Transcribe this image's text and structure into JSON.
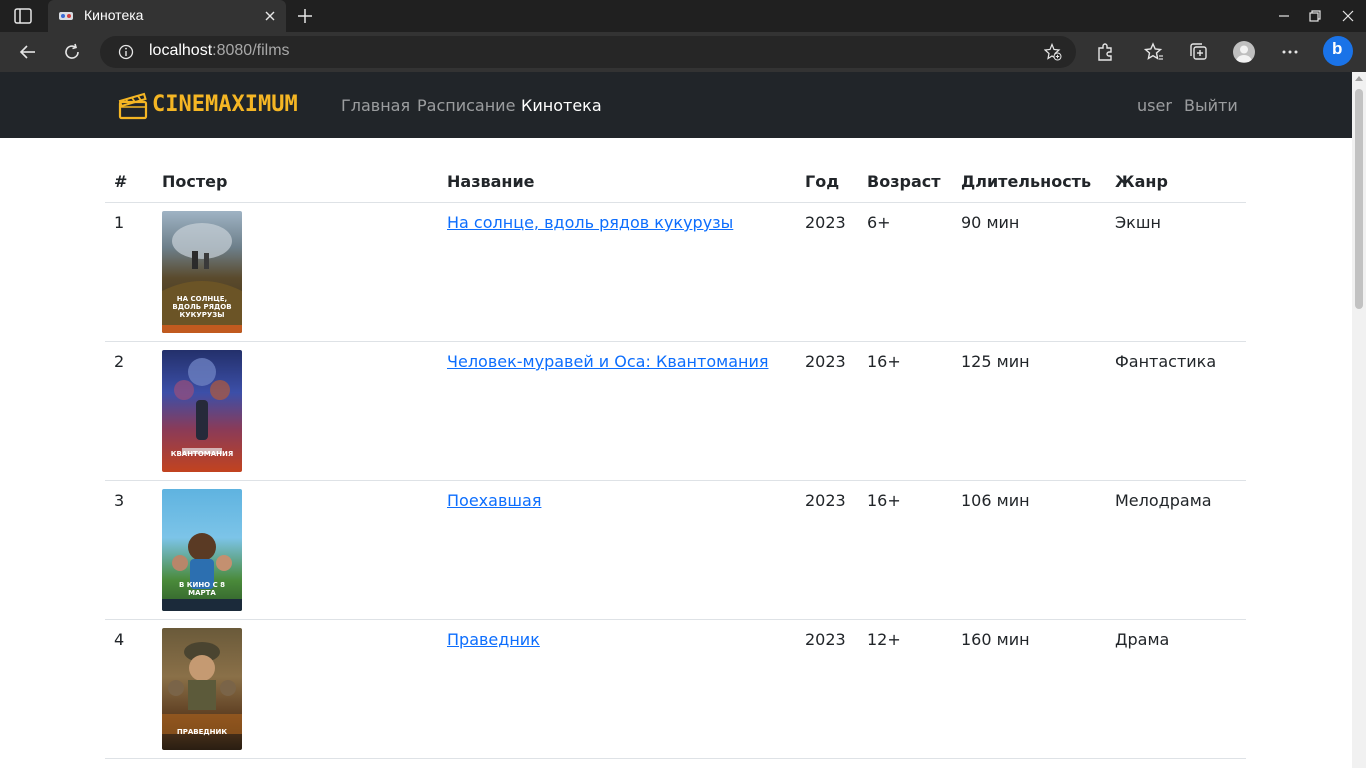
{
  "browser": {
    "tab_title": "Кинотека",
    "url_host": "localhost",
    "url_rest": ":8080/films"
  },
  "site": {
    "brand": "CINEMAXIMUM",
    "nav": [
      {
        "label": "Главная",
        "active": false
      },
      {
        "label": "Расписание",
        "active": false
      },
      {
        "label": "Кинотека",
        "active": true
      }
    ],
    "user": "user",
    "logout": "Выйти",
    "colors": {
      "navbar_bg": "#212529",
      "brand": "#f5b624",
      "link": "#0d6efd"
    }
  },
  "table": {
    "headers": [
      "#",
      "Постер",
      "Название",
      "Год",
      "Возраст",
      "Длительность",
      "Жанр"
    ],
    "rows": [
      {
        "num": "1",
        "title": "На солнце, вдоль рядов кукурузы",
        "year": "2023",
        "age": "6+",
        "duration": "90 мин",
        "genre": "Экшн",
        "poster_caption": "На солнце, вдоль рядов кукурузы"
      },
      {
        "num": "2",
        "title": "Человек-муравей и Оса: Квантомания",
        "year": "2023",
        "age": "16+",
        "duration": "125 мин",
        "genre": "Фантастика",
        "poster_caption": "Квантомания"
      },
      {
        "num": "3",
        "title": "Поехавшая",
        "year": "2023",
        "age": "16+",
        "duration": "106 мин",
        "genre": "Мелодрама",
        "poster_caption": "В кино с 8 марта"
      },
      {
        "num": "4",
        "title": "Праведник",
        "year": "2023",
        "age": "12+",
        "duration": "160 мин",
        "genre": "Драма",
        "poster_caption": "Праведник"
      }
    ]
  }
}
